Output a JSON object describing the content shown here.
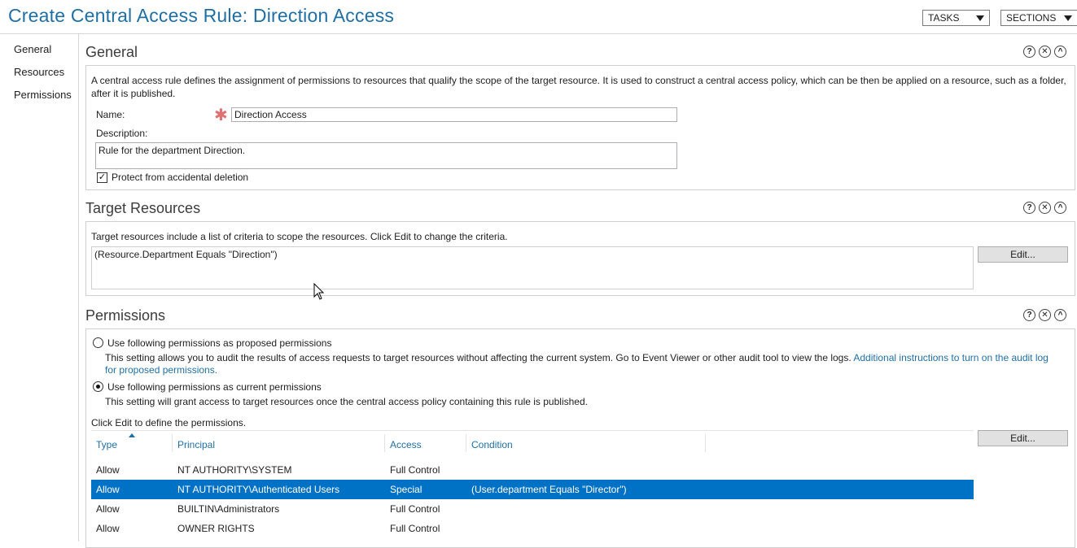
{
  "header": {
    "title": "Create Central Access Rule: Direction Access",
    "tasks_label": "TASKS",
    "sections_label": "SECTIONS"
  },
  "nav": {
    "items": [
      {
        "label": "General"
      },
      {
        "label": "Resources"
      },
      {
        "label": "Permissions"
      }
    ]
  },
  "general": {
    "heading": "General",
    "description_text": "A central access rule defines the assignment of permissions to resources that qualify the scope of the target resource. It is used to construct a central access policy, which can be then be applied on a resource, such as a folder,",
    "description_text2": "after it is published.",
    "name_label": "Name:",
    "name_value": "Direction Access",
    "description_label": "Description:",
    "description_value": "Rule for the department Direction.",
    "protect_label": "Protect from accidental deletion",
    "protect_checked": true
  },
  "target": {
    "heading": "Target Resources",
    "info": "Target resources include a list of criteria to scope the resources. Click Edit to change the criteria.",
    "criteria": "(Resource.Department Equals \"Direction\")",
    "edit_label": "Edit..."
  },
  "permissions": {
    "heading": "Permissions",
    "proposed_label": "Use following permissions as proposed permissions",
    "proposed_desc": "This setting allows you to audit the results of access requests to target resources without affecting the current system. Go to Event Viewer or other audit tool to view the logs.",
    "proposed_link": "Additional instructions to turn on the audit log",
    "proposed_link2": "for proposed permissions.",
    "current_label": "Use following permissions as current permissions",
    "current_desc": "This setting will grant access to target resources once the central access policy containing this rule is published.",
    "selected_option": "current",
    "click_edit": "Click Edit to define the permissions.",
    "edit_label": "Edit...",
    "columns": [
      "Type",
      "Principal",
      "Access",
      "Condition"
    ],
    "rows": [
      {
        "type": "Allow",
        "principal": "NT AUTHORITY\\SYSTEM",
        "access": "Full Control",
        "condition": ""
      },
      {
        "type": "Allow",
        "principal": "NT AUTHORITY\\Authenticated Users",
        "access": "Special",
        "condition": "(User.department Equals \"Director\")"
      },
      {
        "type": "Allow",
        "principal": "BUILTIN\\Administrators",
        "access": "Full Control",
        "condition": ""
      },
      {
        "type": "Allow",
        "principal": "OWNER RIGHTS",
        "access": "Full Control",
        "condition": ""
      }
    ],
    "selected_row": 1
  },
  "icons": {
    "help": "?",
    "close": "✕",
    "collapse": "^"
  }
}
